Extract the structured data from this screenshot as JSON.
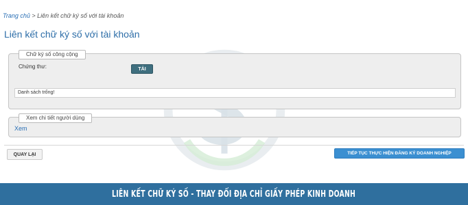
{
  "breadcrumb": {
    "home": "Trang chủ",
    "separator": " > ",
    "current": "Liên kết chữ ký số với tài khoản"
  },
  "page_title": "Liên kết chữ ký số với tài khoản",
  "public_signature": {
    "legend": "Chữ ký số công cộng",
    "certificate_label": "Chứng thư:",
    "load_button": "TẢI",
    "empty_list_text": "Danh sách trống!"
  },
  "user_details": {
    "legend": "Xem chi tiết người dùng",
    "view_link": "Xem"
  },
  "actions": {
    "back_button": "QUAY LẠI",
    "continue_button": "TIẾP TỤC THỰC HIỆN ĐĂNG KÝ DOANH NGHIỆP"
  },
  "banner_text": "LIÊN KẾT CHỮ KÝ SỐ - THAY ĐỔI ĐỊA CHỈ GIẤY PHÉP KINH DOANH",
  "colors": {
    "title": "#2e6ea8",
    "primary_button": "#3b8fd1",
    "banner": "#2f6f9e",
    "load_button": "#3f6f7f"
  }
}
